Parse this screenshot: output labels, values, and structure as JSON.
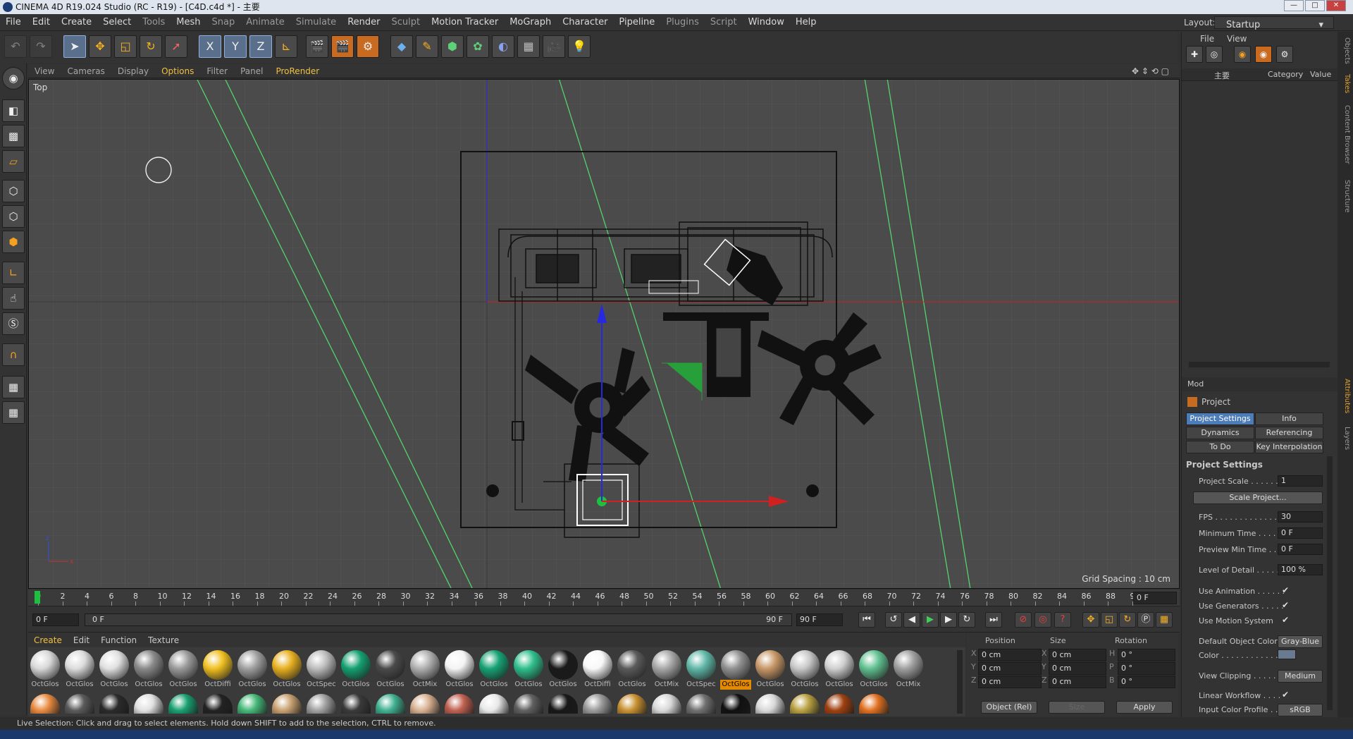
{
  "window": {
    "title": "CINEMA 4D R19.024 Studio (RC - R19) - [C4D.c4d *] - 主要",
    "controls": [
      "—",
      "□",
      "✕"
    ]
  },
  "menu": [
    "File",
    "Edit",
    "Create",
    "Select",
    "Tools",
    "Mesh",
    "Snap",
    "Animate",
    "Simulate",
    "Render",
    "Sculpt",
    "Motion Tracker",
    "MoGraph",
    "Character",
    "Pipeline",
    "Plugins",
    "Script",
    "Window",
    "Help"
  ],
  "layout": {
    "label": "Layout:",
    "value": "Startup"
  },
  "toolbar": {
    "x": "X",
    "y": "Y",
    "z": "Z"
  },
  "view_menu": [
    "View",
    "Cameras",
    "Display",
    "Options",
    "Filter",
    "Panel",
    "ProRender"
  ],
  "viewport": {
    "label": "Top",
    "grid_spacing": "Grid Spacing : 10 cm"
  },
  "timeline": {
    "ticks": [
      "0",
      "2",
      "4",
      "6",
      "8",
      "10",
      "12",
      "14",
      "16",
      "18",
      "20",
      "22",
      "24",
      "26",
      "28",
      "30",
      "32",
      "34",
      "36",
      "38",
      "40",
      "42",
      "44",
      "46",
      "48",
      "50",
      "52",
      "54",
      "56",
      "58",
      "60",
      "62",
      "64",
      "66",
      "68",
      "70",
      "72",
      "74",
      "76",
      "78",
      "80",
      "82",
      "84",
      "86",
      "88",
      "90"
    ],
    "current": "0 F"
  },
  "transport": {
    "start": "0 F",
    "range_start": "0 F",
    "range_end": "90 F",
    "end": "90 F"
  },
  "materials": {
    "menu": [
      "Create",
      "Edit",
      "Function",
      "Texture"
    ],
    "row1": [
      {
        "name": "OctGlos",
        "color": "#d8d8d8"
      },
      {
        "name": "OctGlos",
        "color": "#dcdcdc"
      },
      {
        "name": "OctGlos",
        "color": "#e0e0e0"
      },
      {
        "name": "OctGlos",
        "color": "#8a8a8a"
      },
      {
        "name": "OctGlos",
        "color": "#9a9a9a"
      },
      {
        "name": "OctDiffi",
        "color": "#f0c020"
      },
      {
        "name": "OctGlos",
        "color": "#a0a0a0"
      },
      {
        "name": "OctGlos",
        "color": "#e8b020"
      },
      {
        "name": "OctSpec",
        "color": "#bdbdbd"
      },
      {
        "name": "OctGlos",
        "color": "#14a070"
      },
      {
        "name": "OctGlos",
        "color": "#4a4a4a"
      },
      {
        "name": "OctMix",
        "color": "#b0b0b0"
      },
      {
        "name": "OctGlos",
        "color": "#f4f4f4"
      },
      {
        "name": "OctGlos",
        "color": "#16a274"
      },
      {
        "name": "OctGlos",
        "color": "#2fbf8c"
      },
      {
        "name": "OctGlos",
        "color": "#1a1a1a"
      },
      {
        "name": "OctDiffi",
        "color": "#f8f8f8"
      },
      {
        "name": "OctGlos",
        "color": "#5a5a5a"
      },
      {
        "name": "OctMix",
        "color": "#a8a8a8"
      },
      {
        "name": "OctSpec",
        "color": "#60b8a8"
      },
      {
        "name": "OctGlos",
        "color": "#909090"
      },
      {
        "name": "OctGlos",
        "color": "#c89868"
      },
      {
        "name": "OctGlos",
        "color": "#c8c8c8"
      },
      {
        "name": "OctGlos",
        "color": "#d0d0d0"
      },
      {
        "name": "OctGlos",
        "color": "#60c090"
      },
      {
        "name": "OctMix",
        "color": "#a0a0a0"
      }
    ],
    "row2_colors": [
      "#e88a40",
      "#5a5a5a",
      "#2a2a2a",
      "#e0e0e0",
      "#18a070",
      "#222",
      "#44b878",
      "#c8a070",
      "#a0a0a0",
      "#3a3a3a",
      "#40b090",
      "#d8b090",
      "#c06050",
      "#e8e8e8",
      "#606060",
      "#181818",
      "#9a9a9a",
      "#c89030",
      "#d8d8d8",
      "#707070",
      "#101010",
      "#d8d8d8",
      "#b8a040",
      "#a04010",
      "#e07020"
    ],
    "selected_index": 20
  },
  "coords": {
    "headers": [
      "Position",
      "Size",
      "Rotation"
    ],
    "rows": [
      {
        "axis": "X",
        "pos": "0 cm",
        "size": "0 cm",
        "rot_axis": "H",
        "rot": "0 °"
      },
      {
        "axis": "Y",
        "pos": "0 cm",
        "size": "0 cm",
        "rot_axis": "P",
        "rot": "0 °"
      },
      {
        "axis": "Z",
        "pos": "0 cm",
        "size": "0 cm",
        "rot_axis": "B",
        "rot": "0 °"
      }
    ],
    "mode": "Object (Rel)",
    "size_mode": "Size",
    "apply": "Apply"
  },
  "status": "Live Selection: Click and drag to select elements. Hold down SHIFT to add to the selection, CTRL to remove.",
  "objects": {
    "menu": [
      "File",
      "View"
    ],
    "item": "主要",
    "cols": [
      "Category",
      "Value"
    ]
  },
  "attributes": {
    "mode": "Mod",
    "object": "Project",
    "tabs": [
      "Project Settings",
      "Info",
      "Dynamics",
      "Referencing",
      "To Do",
      "Key Interpolation"
    ],
    "section": "Project Settings",
    "fields": [
      {
        "label": "Project Scale . . . . . .",
        "value": "1"
      },
      {
        "label": "FPS . . . . . . . . . . . . . .",
        "value": "30"
      },
      {
        "label": "Minimum Time . . . . .",
        "value": "0 F"
      },
      {
        "label": "Preview Min Time . . .",
        "value": "0 F"
      },
      {
        "label": "Level of Detail . . . . .",
        "value": "100 %"
      }
    ],
    "scale_btn": "Scale Project...",
    "checks": [
      "Use Animation . . . . . .",
      "Use Generators . . . . .",
      "Use Motion System"
    ],
    "default_color_label": "Default Object Color",
    "default_color_value": "Gray-Blue",
    "color_label": "Color . . . . . . . . . . . .",
    "clipping_label": "View Clipping . . . . . .",
    "clipping_value": "Medium",
    "linear_label": "Linear Workflow . . . .",
    "profile_label": "Input Color Profile . .",
    "profile_value": "sRGB"
  },
  "side_tabs": [
    "Objects",
    "Takes",
    "Content Browser",
    "Structure",
    "Attributes",
    "Layers"
  ],
  "colors": {
    "accent": "#4d7db8",
    "highlight": "#e48a00",
    "viewport_bg": "#4b4b4b",
    "green_line": "#55d36b",
    "x_axis": "#e02020",
    "y_axis": "#2828e0"
  }
}
